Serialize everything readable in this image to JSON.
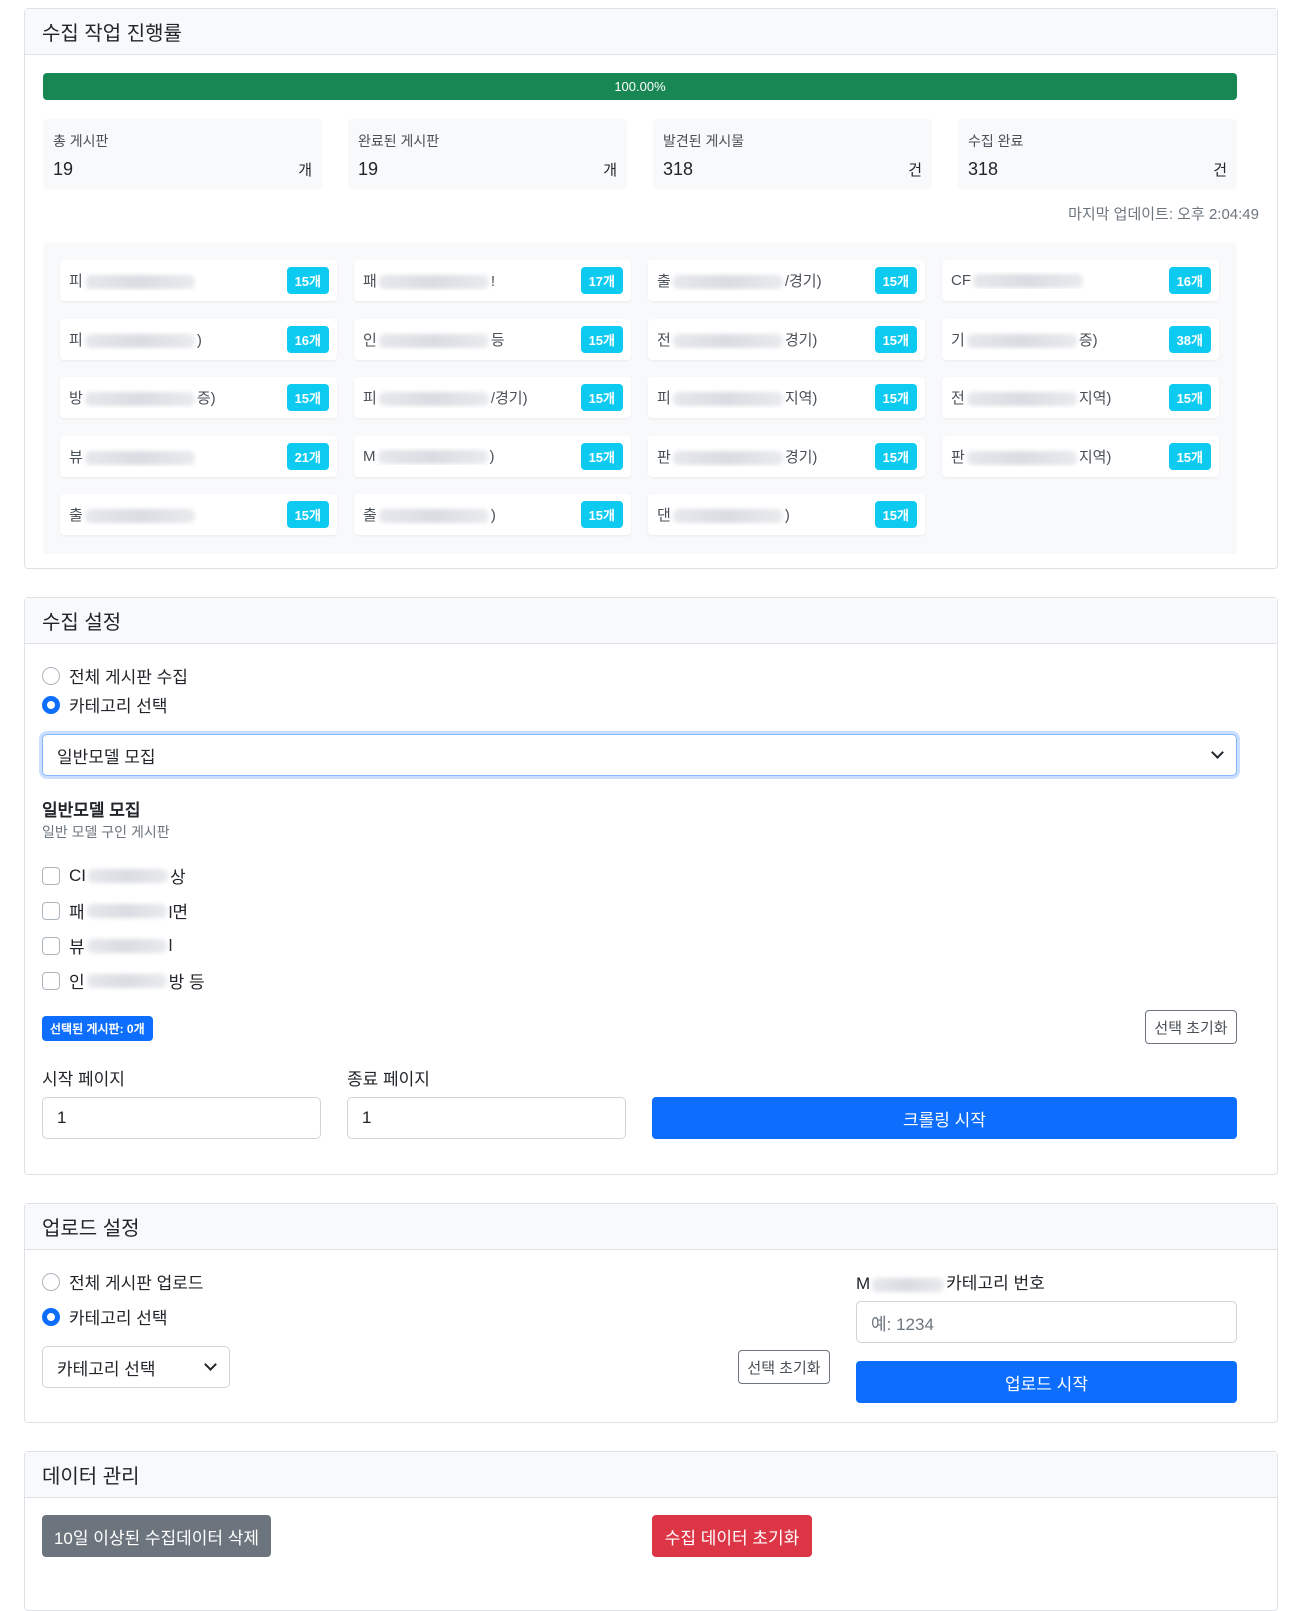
{
  "progress_card": {
    "title": "수집 작업 진행률",
    "progress_percent": 100,
    "progress_label": "100.00%",
    "stats": [
      {
        "label": "총 게시판",
        "value": "19",
        "unit": "개"
      },
      {
        "label": "완료된 게시판",
        "value": "19",
        "unit": "개"
      },
      {
        "label": "발견된 게시물",
        "value": "318",
        "unit": "건"
      },
      {
        "label": "수집 완료",
        "value": "318",
        "unit": "건"
      }
    ],
    "last_update": "마지막 업데이트: 오후 2:04:49",
    "boards": [
      {
        "prefix": "피",
        "suffix": "",
        "count": "15개"
      },
      {
        "prefix": "패",
        "suffix": "!",
        "count": "17개"
      },
      {
        "prefix": "출",
        "suffix": "/경기)",
        "count": "15개"
      },
      {
        "prefix": "CF",
        "suffix": "",
        "count": "16개"
      },
      {
        "prefix": "피",
        "suffix": ")",
        "count": "16개"
      },
      {
        "prefix": "인",
        "suffix": "등",
        "count": "15개"
      },
      {
        "prefix": "전",
        "suffix": "경기)",
        "count": "15개"
      },
      {
        "prefix": "기",
        "suffix": "증)",
        "count": "38개"
      },
      {
        "prefix": "방",
        "suffix": "증)",
        "count": "15개"
      },
      {
        "prefix": "피",
        "suffix": "/경기)",
        "count": "15개"
      },
      {
        "prefix": "피",
        "suffix": "지역)",
        "count": "15개"
      },
      {
        "prefix": "전",
        "suffix": "지역)",
        "count": "15개"
      },
      {
        "prefix": "뷰",
        "suffix": "",
        "count": "21개"
      },
      {
        "prefix": "M",
        "suffix": ")",
        "count": "15개"
      },
      {
        "prefix": "판",
        "suffix": "경기)",
        "count": "15개"
      },
      {
        "prefix": "판",
        "suffix": "지역)",
        "count": "15개"
      },
      {
        "prefix": "출",
        "suffix": "",
        "count": "15개"
      },
      {
        "prefix": "출",
        "suffix": ")",
        "count": "15개"
      },
      {
        "prefix": "댄",
        "suffix": ")",
        "count": "15개"
      }
    ]
  },
  "collect_card": {
    "title": "수집 설정",
    "radio_all": "전체 게시판 수집",
    "radio_category": "카테고리 선택",
    "category_select": "일반모델 모집",
    "category_title": "일반모델 모집",
    "category_desc": "일반 모델 구인 게시판",
    "checkboxes": [
      {
        "prefix": "CI",
        "suffix": "상"
      },
      {
        "prefix": "패",
        "suffix": "l면"
      },
      {
        "prefix": "뷰",
        "suffix": "l"
      },
      {
        "prefix": "인",
        "suffix": "방 등"
      }
    ],
    "selected_badge": "선택된 게시판: 0개",
    "reset_button": "선택 초기화",
    "start_page_label": "시작 페이지",
    "start_page_value": "1",
    "end_page_label": "종료 페이지",
    "end_page_value": "1",
    "crawl_button": "크롤링 시작"
  },
  "upload_card": {
    "title": "업로드 설정",
    "radio_all": "전체 게시판 업로드",
    "radio_category": "카테고리 선택",
    "category_select": "카테고리 선택",
    "reset_button": "선택 초기화",
    "category_number_prefix": "M",
    "category_number_label": "카테고리 번호",
    "category_number_placeholder": "예: 1234",
    "upload_button": "업로드 시작"
  },
  "data_card": {
    "title": "데이터 관리",
    "delete_old_button": "10일 이상된 수집데이터 삭제",
    "reset_data_button": "수집 데이터 초기화"
  },
  "colors": {
    "primary": "#0d6efd",
    "success": "#198754",
    "info": "#0dcaf0",
    "danger": "#dc3545",
    "secondary": "#6c757d"
  }
}
